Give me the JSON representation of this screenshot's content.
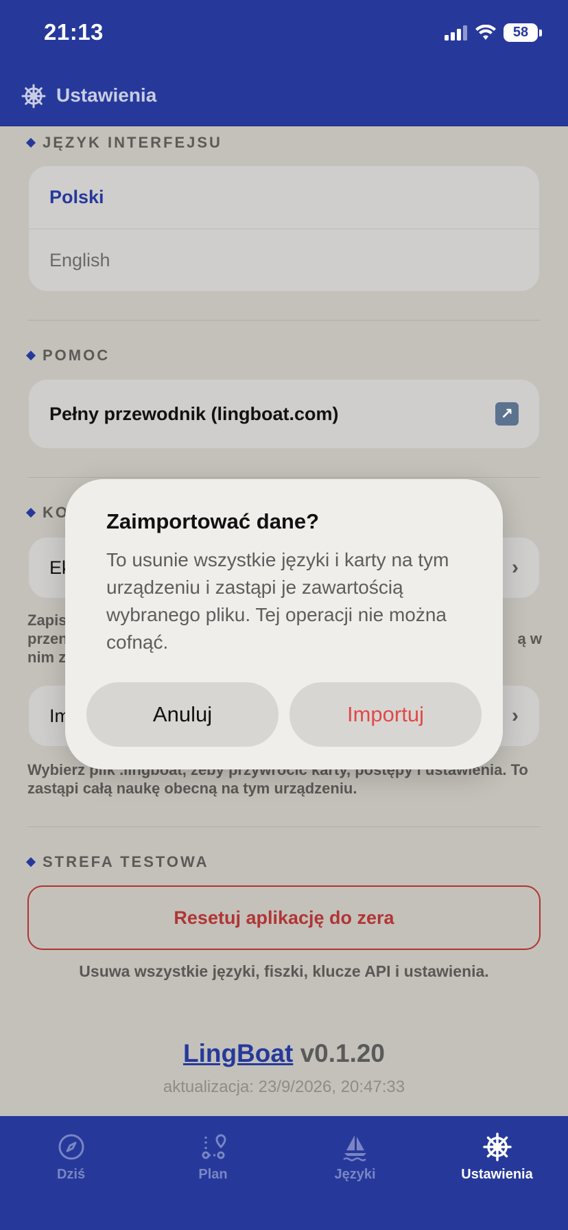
{
  "status_bar": {
    "time": "21:13",
    "battery": "58"
  },
  "header": {
    "title": "Ustawienia",
    "icon": "ship-wheel-icon"
  },
  "language_section": {
    "label": "JĘZYK INTERFEJSU",
    "options": [
      {
        "label": "Polski",
        "selected": true
      },
      {
        "label": "English",
        "selected": false
      }
    ]
  },
  "help_section": {
    "label": "POMOC",
    "guide_label": "Pełny przewodnik (lingboat.com)"
  },
  "backup_section": {
    "label_visible": "KO",
    "export_label_visible": "Ek",
    "export_help_line1": "Zapis",
    "export_help_line2_start": "przen",
    "export_help_line2_end": "ą w",
    "export_help_line3": "nim z",
    "import_label_visible": "Im",
    "import_help": "Wybierz plik .lingboat, żeby przywrócić karty, postępy i ustawienia. To zastąpi całą naukę obecną na tym urządzeniu."
  },
  "test_section": {
    "label": "STREFA TESTOWA",
    "reset_label": "Resetuj aplikację do zera",
    "reset_note": "Usuwa wszystkie języki, fiszki, klucze API i ustawienia."
  },
  "footer": {
    "brand": "LingBoat",
    "version": "v0.1.20",
    "updated": "aktualizacja: 23/9/2026, 20:47:33"
  },
  "tabs": [
    {
      "label": "Dziś",
      "icon": "compass-icon",
      "active": false
    },
    {
      "label": "Plan",
      "icon": "route-icon",
      "active": false
    },
    {
      "label": "Języki",
      "icon": "sailboat-icon",
      "active": false
    },
    {
      "label": "Ustawienia",
      "icon": "ship-wheel-icon",
      "active": true
    }
  ],
  "dialog": {
    "title": "Zaimportować dane?",
    "message": "To usunie wszystkie języki i karty na tym urządzeniu i zastąpi je zawartością wybranego pliku. Tej operacji nie można cofnąć.",
    "cancel_label": "Anuluj",
    "confirm_label": "Importuj"
  },
  "colors": {
    "primary": "#26399b",
    "danger": "#b03333",
    "confirm": "#e0494a"
  }
}
